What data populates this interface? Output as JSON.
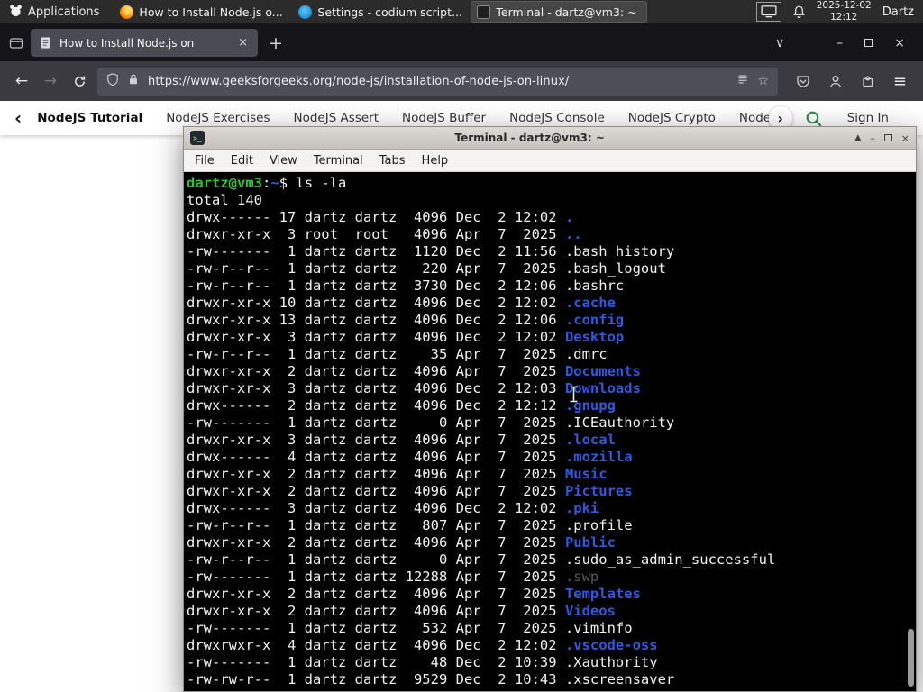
{
  "panel": {
    "applications_label": "Applications",
    "tasks": [
      {
        "icon": "firefox-icon",
        "label": "How to Install Node.js o...",
        "active": false
      },
      {
        "icon": "codium-icon",
        "label": "Settings - codium script...",
        "active": false
      },
      {
        "icon": "terminal-icon",
        "label": "Terminal - dartz@vm3: ~",
        "active": true
      }
    ],
    "clock_date": "2025-12-02",
    "clock_time": "12:12",
    "user_label": "Dartz"
  },
  "browser": {
    "tab_title": "How to Install Node.js on",
    "tab_close": "×",
    "new_tab": "+",
    "list_tabs": "∨",
    "minimize": "–",
    "close": "×",
    "back": "←",
    "forward": "→",
    "url": "https://www.geeksforgeeks.org/node-js/installation-of-node-js-on-linux/",
    "bookmark_star": "☆",
    "menu": "≡"
  },
  "gfg_nav": {
    "back_chevron": "‹",
    "forward_chevron": "›",
    "items": [
      {
        "label": "NodeJS Tutorial",
        "bold": true
      },
      {
        "label": "NodeJS Exercises"
      },
      {
        "label": "NodeJS Assert"
      },
      {
        "label": "NodeJS Buffer"
      },
      {
        "label": "NodeJS Console"
      },
      {
        "label": "NodeJS Crypto"
      },
      {
        "label": "NodeJS DNS"
      },
      {
        "label": "Node"
      }
    ],
    "sign_in": "Sign In"
  },
  "terminal": {
    "window_title": "Terminal - dartz@vm3: ~",
    "icon_glyph": ">_",
    "window_buttons": {
      "shade": "▲",
      "minimize": "–",
      "close": "×"
    },
    "menu_items": [
      "File",
      "Edit",
      "View",
      "Terminal",
      "Tabs",
      "Help"
    ],
    "prompt": {
      "user_host": "dartz@vm3",
      "colon": ":",
      "path": "~",
      "symbol": "$ ",
      "command": "ls -la"
    },
    "total_line": "total 140",
    "listing": [
      {
        "prefix": "drwx------ 17 dartz dartz  4096 Dec  2 12:02 ",
        "name": ".",
        "type": "dir"
      },
      {
        "prefix": "drwxr-xr-x  3 root  root   4096 Apr  7  2025 ",
        "name": "..",
        "type": "dir"
      },
      {
        "prefix": "-rw-------  1 dartz dartz  1120 Dec  2 11:56 ",
        "name": ".bash_history",
        "type": "file"
      },
      {
        "prefix": "-rw-r--r--  1 dartz dartz   220 Apr  7  2025 ",
        "name": ".bash_logout",
        "type": "file"
      },
      {
        "prefix": "-rw-r--r--  1 dartz dartz  3730 Dec  2 12:06 ",
        "name": ".bashrc",
        "type": "file"
      },
      {
        "prefix": "drwxr-xr-x 10 dartz dartz  4096 Dec  2 12:02 ",
        "name": ".cache",
        "type": "dir"
      },
      {
        "prefix": "drwxr-xr-x 13 dartz dartz  4096 Dec  2 12:06 ",
        "name": ".config",
        "type": "dir"
      },
      {
        "prefix": "drwxr-xr-x  3 dartz dartz  4096 Dec  2 12:02 ",
        "name": "Desktop",
        "type": "dir"
      },
      {
        "prefix": "-rw-r--r--  1 dartz dartz    35 Apr  7  2025 ",
        "name": ".dmrc",
        "type": "file"
      },
      {
        "prefix": "drwxr-xr-x  2 dartz dartz  4096 Apr  7  2025 ",
        "name": "Documents",
        "type": "dir"
      },
      {
        "prefix": "drwxr-xr-x  3 dartz dartz  4096 Dec  2 12:03 ",
        "name": "Downloads",
        "type": "dir"
      },
      {
        "prefix": "drwx------  2 dartz dartz  4096 Dec  2 12:12 ",
        "name": ".gnupg",
        "type": "dir"
      },
      {
        "prefix": "-rw-------  1 dartz dartz     0 Apr  7  2025 ",
        "name": ".ICEauthority",
        "type": "file"
      },
      {
        "prefix": "drwxr-xr-x  3 dartz dartz  4096 Apr  7  2025 ",
        "name": ".local",
        "type": "dir"
      },
      {
        "prefix": "drwx------  4 dartz dartz  4096 Apr  7  2025 ",
        "name": ".mozilla",
        "type": "dir"
      },
      {
        "prefix": "drwxr-xr-x  2 dartz dartz  4096 Apr  7  2025 ",
        "name": "Music",
        "type": "dir"
      },
      {
        "prefix": "drwxr-xr-x  2 dartz dartz  4096 Apr  7  2025 ",
        "name": "Pictures",
        "type": "dir"
      },
      {
        "prefix": "drwx------  3 dartz dartz  4096 Dec  2 12:02 ",
        "name": ".pki",
        "type": "dir"
      },
      {
        "prefix": "-rw-r--r--  1 dartz dartz   807 Apr  7  2025 ",
        "name": ".profile",
        "type": "file"
      },
      {
        "prefix": "drwxr-xr-x  2 dartz dartz  4096 Apr  7  2025 ",
        "name": "Public",
        "type": "dir"
      },
      {
        "prefix": "-rw-r--r--  1 dartz dartz     0 Apr  7  2025 ",
        "name": ".sudo_as_admin_successful",
        "type": "file"
      },
      {
        "prefix": "-rw-------  1 dartz dartz 12288 Apr  7  2025 ",
        "name": ".swp",
        "type": "dim"
      },
      {
        "prefix": "drwxr-xr-x  2 dartz dartz  4096 Apr  7  2025 ",
        "name": "Templates",
        "type": "dir"
      },
      {
        "prefix": "drwxr-xr-x  2 dartz dartz  4096 Apr  7  2025 ",
        "name": "Videos",
        "type": "dir"
      },
      {
        "prefix": "-rw-------  1 dartz dartz   532 Apr  7  2025 ",
        "name": ".viminfo",
        "type": "file"
      },
      {
        "prefix": "drwxrwxr-x  4 dartz dartz  4096 Dec  2 12:02 ",
        "name": ".vscode-oss",
        "type": "dir"
      },
      {
        "prefix": "-rw-------  1 dartz dartz    48 Dec  2 10:39 ",
        "name": ".Xauthority",
        "type": "file"
      },
      {
        "prefix": "-rw-rw-r--  1 dartz dartz  9529 Dec  2 10:43 ",
        "name": ".xscreensaver",
        "type": "file"
      }
    ]
  },
  "colors": {
    "gfg_green": "#2f8d46",
    "terminal_green": "#30c530",
    "terminal_blue": "#2f5ae0",
    "terminal_fg": "#f2f2f2",
    "terminal_dim": "#585858",
    "panel_bg": "#2b2b2b",
    "firefox_tabbar_bg": "#151419",
    "firefox_toolbar_bg": "#3b3a41"
  }
}
